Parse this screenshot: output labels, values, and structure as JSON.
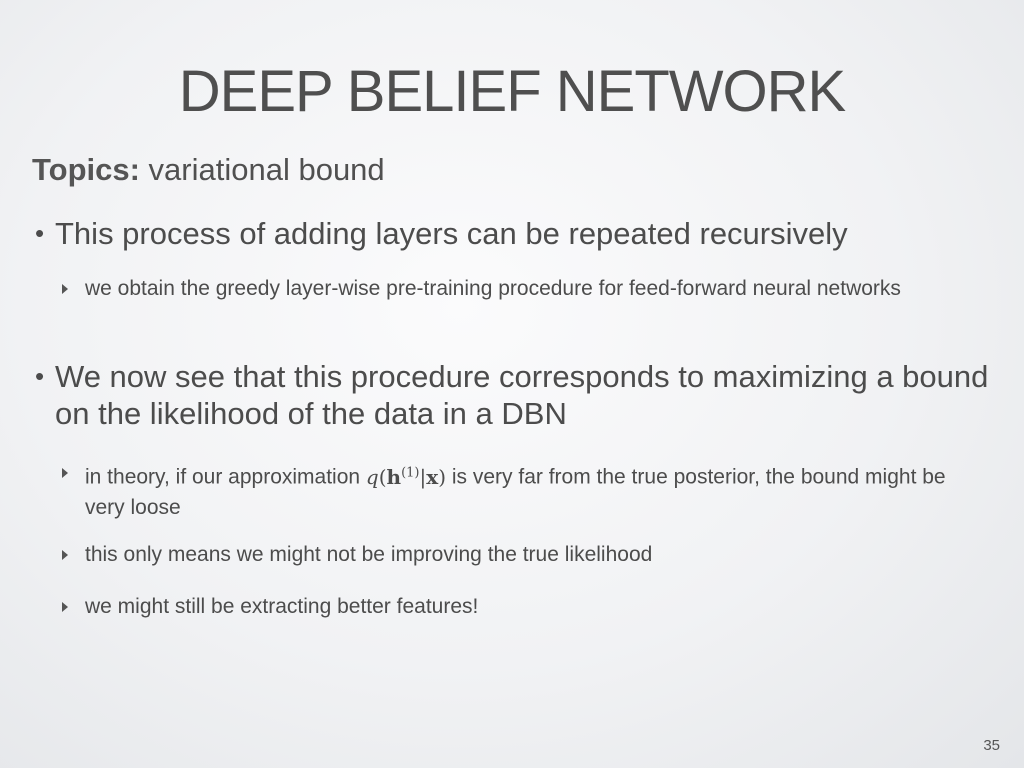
{
  "slide": {
    "title": "DEEP BELIEF NETWORK",
    "topics_label": "Topics:",
    "topics_value": " variational bound",
    "bullet1": "This process of adding layers can be repeated recursively",
    "sub1": "we obtain the greedy layer-wise pre-training procedure for feed-forward neural networks",
    "bullet2": "We now see that this procedure corresponds to maximizing a bound on the likelihood of the data in a DBN",
    "sub2_before": "in theory, if our approximation ",
    "sub2_math_q": "q",
    "sub2_math_h": "h",
    "sub2_math_sup": "(1)",
    "sub2_math_x": "x",
    "sub2_after": " is very far from the true posterior, the bound might be very loose",
    "sub3": "this only means we might not be improving the true likelihood",
    "sub4": "we might still be extracting better features!",
    "page_number": "35"
  }
}
